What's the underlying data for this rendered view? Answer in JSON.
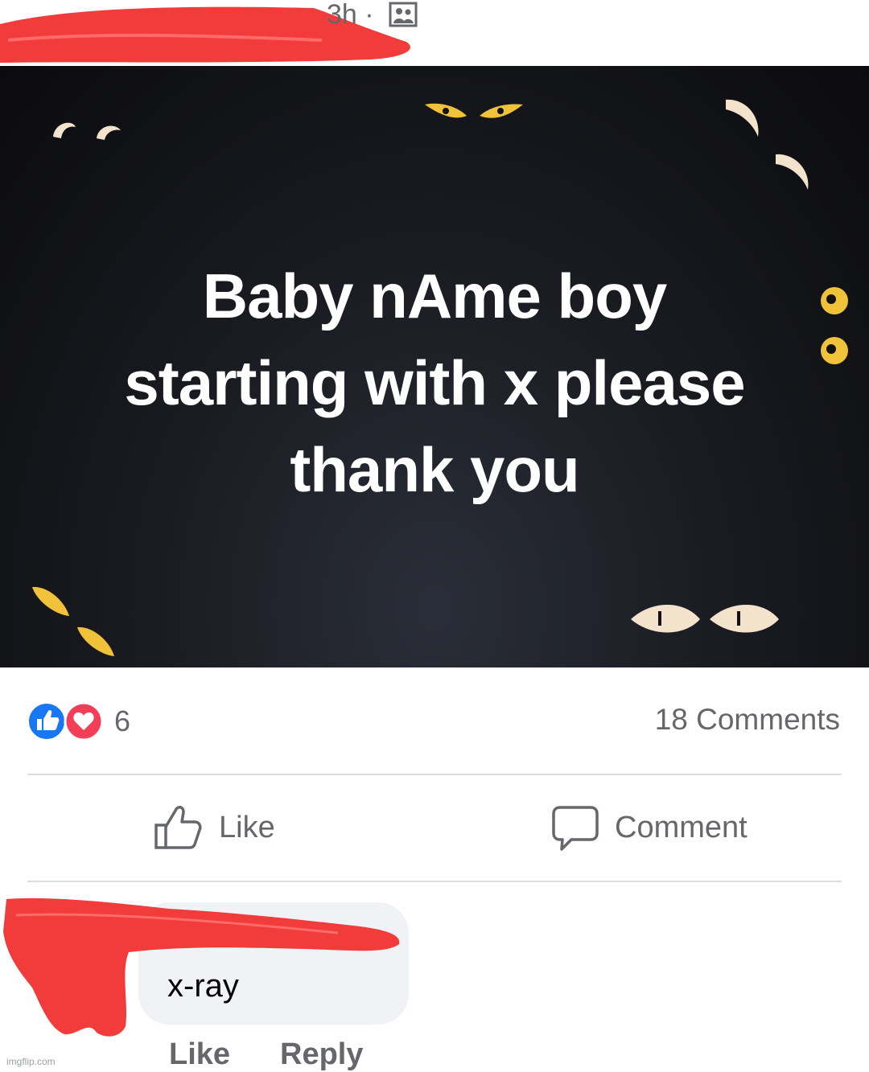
{
  "post": {
    "timestamp": "3h ·",
    "audience_icon": "friends-icon",
    "image_text": "Baby nAme boy\nstarting  with x please\nthank you"
  },
  "reactions": {
    "icons": [
      "like-icon",
      "love-icon"
    ],
    "count": "6",
    "comments_count": "18 Comments"
  },
  "actions": {
    "like_label": "Like",
    "comment_label": "Comment"
  },
  "comment": {
    "text": "x-ray",
    "like_label": "Like",
    "reply_label": "Reply"
  },
  "watermark": "imgflip.com",
  "colors": {
    "like_blue": "#1877f2",
    "love_red": "#f33e58",
    "scribble_red": "#f23b3b",
    "secondary_text": "#65676b",
    "eye_yellow": "#f0c23a",
    "eye_cream": "#f3e3cc"
  }
}
